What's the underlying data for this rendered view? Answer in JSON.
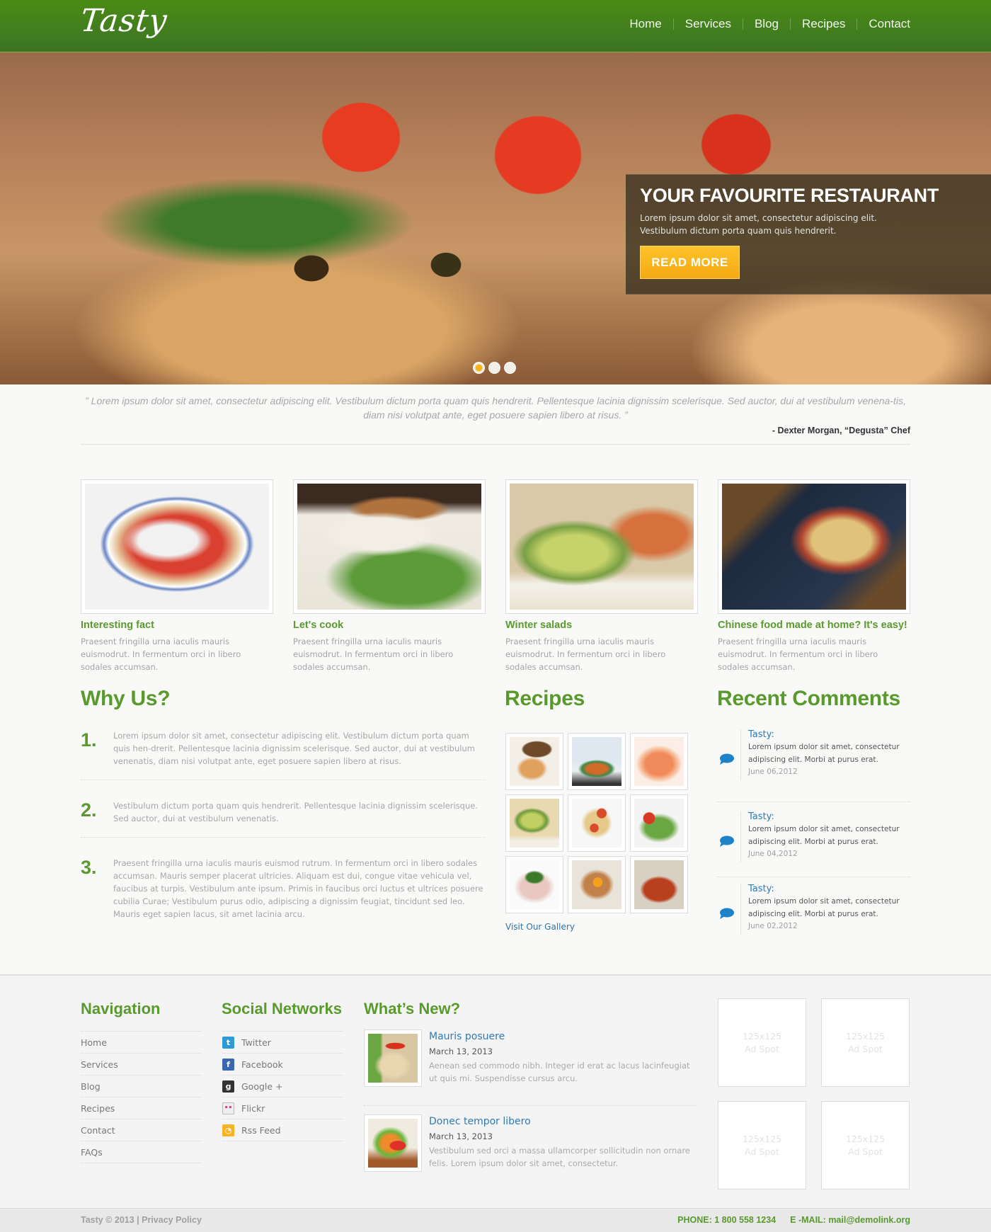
{
  "header": {
    "logo": "Tasty",
    "nav": [
      "Home",
      "Services",
      "Blog",
      "Recipes",
      "Contact"
    ]
  },
  "hero": {
    "title": "YOUR FAVOURITE RESTAURANT",
    "text": "Lorem ipsum dolor sit amet, consectetur adipiscing elit. Vestibulum dictum porta quam quis hendrerit.",
    "button": "READ MORE",
    "slides": 3,
    "active_slide": 1
  },
  "quote": {
    "text": "” Lorem ipsum dolor sit amet, consectetur adipiscing elit. Vestibulum dictum porta quam quis hendrerit. Pellentesque lacinia dignissim scelerisque. Sed auctor, dui at vestibulum venena-tis, diam nisi volutpat ante, eget posuere sapien libero at risus. ”",
    "author": "- Dexter Morgan, “Degusta” Chef"
  },
  "cards": [
    {
      "title": "Interesting fact",
      "text": "Praesent fringilla urna iaculis mauris euismodrut. In fermentum orci in libero sodales accumsan.",
      "image": "noodle-salad-bowl"
    },
    {
      "title": "Let's cook",
      "text": "Praesent fringilla urna iaculis mauris euismodrut. In fermentum orci in libero sodales accumsan.",
      "image": "grilled-fish-salad"
    },
    {
      "title": "Winter salads",
      "text": "Praesent fringilla urna iaculis mauris euismodrut. In fermentum orci in libero sodales accumsan.",
      "image": "mango-salad"
    },
    {
      "title": "Chinese food made at home? It's easy!",
      "text": "Praesent fringilla urna iaculis mauris euismodrut. In fermentum orci in libero sodales accumsan.",
      "image": "chinese-noodles"
    }
  ],
  "why_us": {
    "title": "Why Us?",
    "items": [
      {
        "num": "1.",
        "text": "Lorem ipsum dolor sit amet, consectetur adipiscing elit. Vestibulum dictum porta quam quis hen-drerit. Pellentesque lacinia dignissim scelerisque. Sed auctor, dui at vestibulum venenatis, diam nisi volutpat ante, eget posuere sapien libero at risus."
      },
      {
        "num": "2.",
        "text": "Vestibulum dictum porta quam quis hendrerit. Pellentesque lacinia dignissim scelerisque. Sed auctor, dui at vestibulum venenatis."
      },
      {
        "num": "3.",
        "text": "Praesent fringilla urna iaculis mauris euismod rutrum. In fermentum orci in libero sodales accumsan. Mauris semper placerat ultricies. Aliquam est dui, congue vitae vehicula vel, faucibus at turpis. Vestibulum ante ipsum. Primis in faucibus orci luctus et ultrices posuere cubilia Curae; Vestibulum purus odio, adipiscing a dignissim feugiat, tincidunt sed leo. Mauris eget sapien lacus, sit amet lacinia arcu."
      }
    ]
  },
  "recipes": {
    "title": "Recipes",
    "thumbs": [
      "sandwich-plate",
      "stir-fry",
      "shrimp",
      "green-salad",
      "pasta-rolls",
      "tomato-salad",
      "meat-herbs",
      "vegetable-dish",
      "tomato-soup"
    ],
    "link": "Visit Our Gallery"
  },
  "comments": {
    "title": "Recent Comments",
    "items": [
      {
        "author": "Tasty:",
        "text": "Lorem ipsum dolor sit amet, consectetur adipiscing elit. Morbi at purus erat.",
        "date": "June 06,2012"
      },
      {
        "author": "Tasty:",
        "text": "Lorem ipsum dolor sit amet, consectetur adipiscing elit. Morbi at purus erat.",
        "date": "June 04,2012"
      },
      {
        "author": "Tasty:",
        "text": "Lorem ipsum dolor sit amet, consectetur adipiscing elit. Morbi at purus erat.",
        "date": "June 02,2012"
      }
    ]
  },
  "footer": {
    "navigation": {
      "title": "Navigation",
      "items": [
        "Home",
        "Services",
        "Blog",
        "Recipes",
        "Contact",
        "FAQs"
      ]
    },
    "social": {
      "title": "Social Networks",
      "items": [
        {
          "label": "Twitter",
          "icon": "twitter-icon",
          "color": "#2f9ad8",
          "glyph": "t"
        },
        {
          "label": "Facebook",
          "icon": "facebook-icon",
          "color": "#3b65b0",
          "glyph": "f"
        },
        {
          "label": "Google +",
          "icon": "google-plus-icon",
          "color": "#333333",
          "glyph": "g"
        },
        {
          "label": "Flickr",
          "icon": "flickr-icon",
          "color": "#eeeeee",
          "glyph": "••"
        },
        {
          "label": "Rss Feed",
          "icon": "rss-icon",
          "color": "#f6b324",
          "glyph": "◔"
        }
      ]
    },
    "news": {
      "title": "What’s New?",
      "items": [
        {
          "title": "Mauris posuere",
          "date": "March 13, 2013",
          "text": "Aenean sed commodo nibh. Integer id erat ac lacus lacinfeugiat ut quis mi. Suspendisse cursus arcu.",
          "image": "chicken-dish"
        },
        {
          "title": "Donec tempor libero",
          "date": "March 13, 2013",
          "text": "Vestibulum sed orci a massa ullamcorper sollicitudin non ornare felis. Lorem ipsum dolor sit amet, consectetur.",
          "image": "veggie-salad"
        }
      ]
    },
    "ads": [
      "125x125\nAd Spot",
      "125x125\nAd Spot",
      "125x125\nAd Spot",
      "125x125\nAd Spot"
    ]
  },
  "bottom": {
    "copyright": "Tasty © 2013 | Privacy Policy",
    "phone": "PHONE: 1 800 558 1234",
    "email": "E -MAIL: mail@demolink.org"
  },
  "colors": {
    "brand_green": "#4a8b14",
    "heading_green": "#589a2c",
    "link_blue": "#2f7ab6",
    "button_yellow": "#fbb41c"
  }
}
